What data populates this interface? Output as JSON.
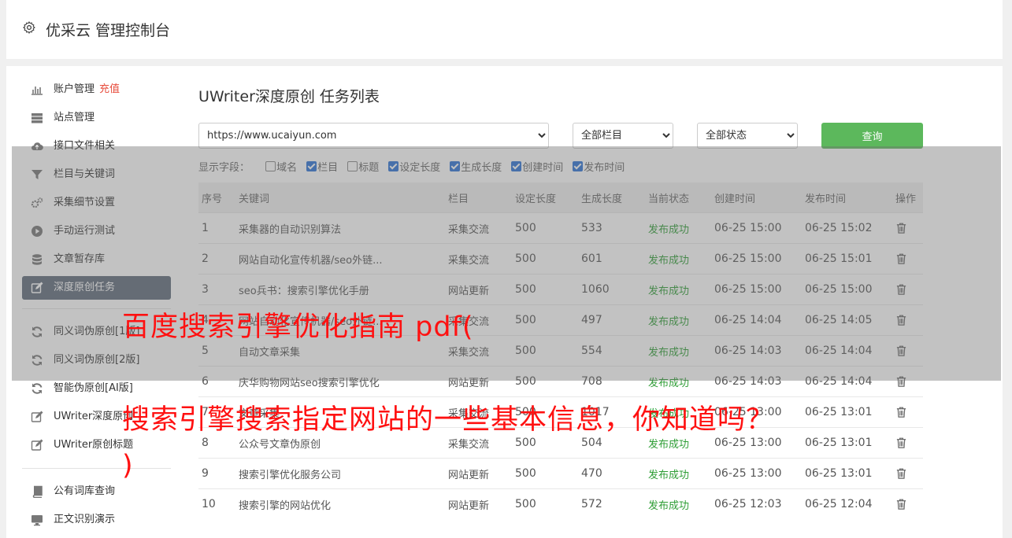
{
  "header": {
    "title": "优采云 管理控制台"
  },
  "sidebar": {
    "items": [
      {
        "label": "账户管理",
        "extra": "充值",
        "icon": "bar-chart-icon"
      },
      {
        "label": "站点管理",
        "icon": "server-icon"
      },
      {
        "label": "接口文件相关",
        "icon": "cloud-upload-icon"
      },
      {
        "label": "栏目与关键词",
        "icon": "filter-icon"
      },
      {
        "label": "采集细节设置",
        "icon": "gears-icon"
      },
      {
        "label": "手动运行测试",
        "icon": "play-circle-icon"
      },
      {
        "label": "文章暂存库",
        "icon": "database-icon"
      },
      {
        "label": "深度原创任务",
        "icon": "edit-icon",
        "active": true
      },
      {
        "label": "同义词伪原创[1版]",
        "icon": "refresh-icon"
      },
      {
        "label": "同义词伪原创[2版]",
        "icon": "refresh-icon"
      },
      {
        "label": "智能伪原创[AI版]",
        "icon": "refresh-icon"
      },
      {
        "label": "UWriter深度原创",
        "icon": "edit-icon"
      },
      {
        "label": "UWriter原创标题",
        "icon": "edit-icon"
      },
      {
        "label": "公有词库查询",
        "icon": "book-icon"
      },
      {
        "label": "正文识别演示",
        "icon": "monitor-icon"
      }
    ]
  },
  "main": {
    "title": "UWriter深度原创 任务列表",
    "site_select": "https://www.ucaiyun.com",
    "column_select": "全部栏目",
    "status_select": "全部状态",
    "query_label": "查询",
    "fields_label": "显示字段：",
    "fields": [
      {
        "label": "域名",
        "checked": false
      },
      {
        "label": "栏目",
        "checked": true
      },
      {
        "label": "标题",
        "checked": false
      },
      {
        "label": "设定长度",
        "checked": true
      },
      {
        "label": "生成长度",
        "checked": true
      },
      {
        "label": "创建时间",
        "checked": true
      },
      {
        "label": "发布时间",
        "checked": true
      }
    ],
    "columns": [
      "序号",
      "关键词",
      "栏目",
      "设定长度",
      "生成长度",
      "当前状态",
      "创建时间",
      "发布时间",
      "操作"
    ],
    "rows": [
      [
        "1",
        "采集器的自动识别算法",
        "采集交流",
        "500",
        "533",
        "发布成功",
        "06-25 15:00",
        "06-25 15:02"
      ],
      [
        "2",
        "网站自动化宣传机器/seo外链...",
        "采集交流",
        "500",
        "601",
        "发布成功",
        "06-25 15:00",
        "06-25 15:01"
      ],
      [
        "3",
        "seo兵书：搜索引擎优化手册",
        "网站更新",
        "500",
        "1060",
        "发布成功",
        "06-25 15:00",
        "06-25 15:00"
      ],
      [
        "4",
        "网站自动化宣传机器/seo外链...",
        "采集交流",
        "500",
        "497",
        "发布成功",
        "06-25 14:04",
        "06-25 14:05"
      ],
      [
        "5",
        "自动文章采集",
        "采集交流",
        "500",
        "554",
        "发布成功",
        "06-25 14:03",
        "06-25 14:04"
      ],
      [
        "6",
        "庆华购物网站seo搜索引擎优化",
        "网站更新",
        "500",
        "708",
        "发布成功",
        "06-25 14:03",
        "06-25 14:04"
      ],
      [
        "7",
        "文章采集",
        "采集交流",
        "500",
        "1017",
        "发布成功",
        "06-25 13:00",
        "06-25 13:01"
      ],
      [
        "8",
        "公众号文章伪原创",
        "采集交流",
        "500",
        "504",
        "发布成功",
        "06-25 13:00",
        "06-25 13:01"
      ],
      [
        "9",
        "搜索引擎优化服务公司",
        "网站更新",
        "500",
        "470",
        "发布成功",
        "06-25 13:00",
        "06-25 13:01"
      ],
      [
        "10",
        "搜索引擎的网站优化",
        "网站更新",
        "500",
        "572",
        "发布成功",
        "06-25 12:03",
        "06-25 12:04"
      ]
    ]
  },
  "watermark": {
    "line1": "百度搜索引擎优化指南 pdf(",
    "line2": "搜索引擎搜索指定网站的一些基本信息，你知道吗？",
    "line3": ")"
  }
}
